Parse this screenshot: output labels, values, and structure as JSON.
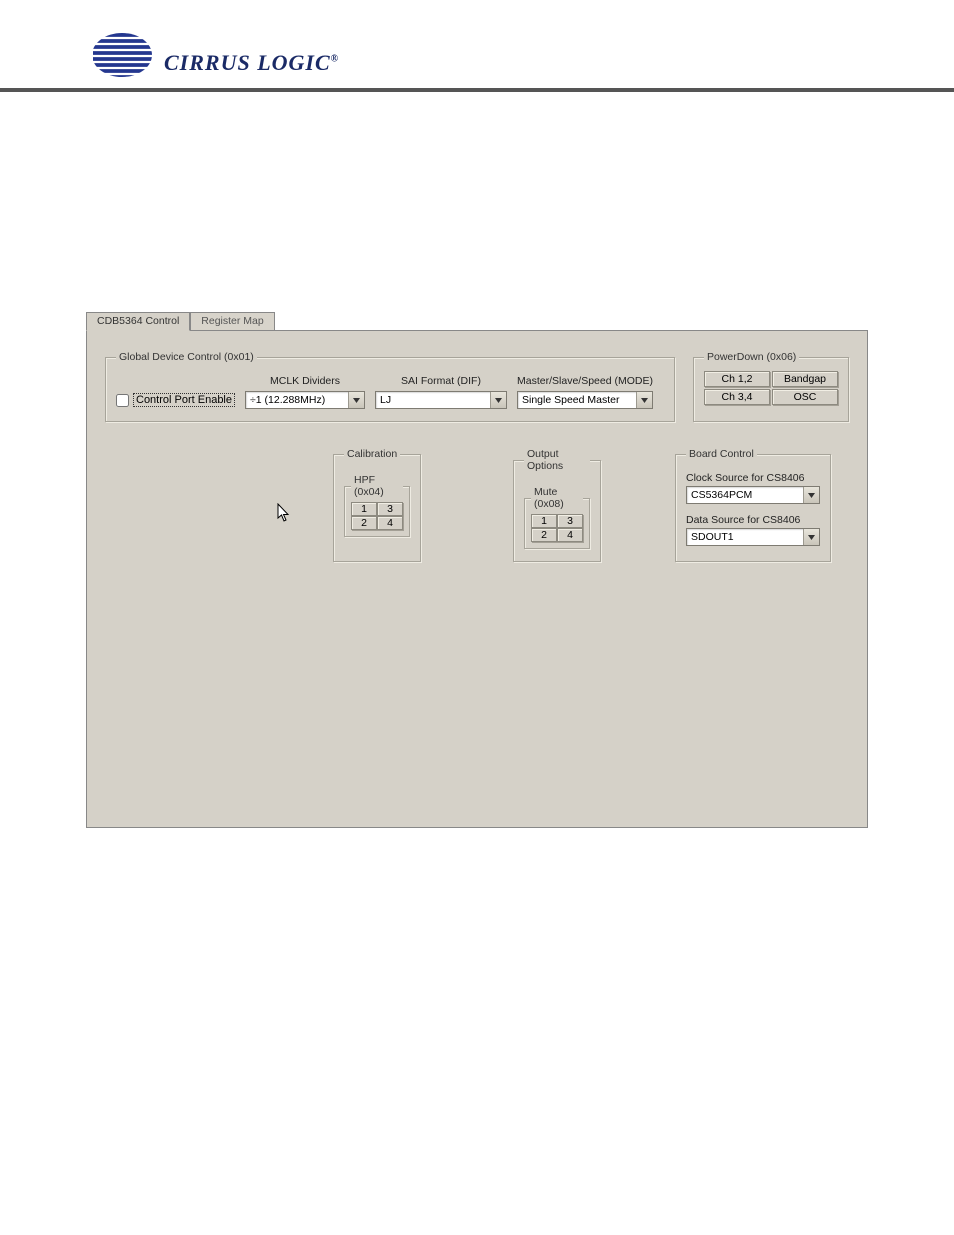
{
  "logo_text": "CIRRUS LOGIC",
  "tabs": [
    {
      "label": "CDB5364 Control",
      "active": true
    },
    {
      "label": "Register Map",
      "active": false
    }
  ],
  "gdc": {
    "legend": "Global Device Control (0x01)",
    "cport_label": "Control Port Enable",
    "mclk_label": "MCLK Dividers",
    "mclk_value": "÷1   (12.288MHz)",
    "sai_label": "SAI Format (DIF)",
    "sai_value": "LJ",
    "mode_label": "Master/Slave/Speed (MODE)",
    "mode_value": "Single Speed Master"
  },
  "powerdown": {
    "legend": "PowerDown (0x06)",
    "buttons": [
      "Ch 1,2",
      "Bandgap",
      "Ch 3,4",
      "OSC"
    ]
  },
  "calibration": {
    "legend": "Calibration",
    "hpf_legend": "HPF (0x04)",
    "cells": [
      "1",
      "3",
      "2",
      "4"
    ]
  },
  "output_options": {
    "legend": "Output Options",
    "mute_legend": "Mute (0x08)",
    "cells": [
      "1",
      "3",
      "2",
      "4"
    ]
  },
  "board_control": {
    "legend": "Board Control",
    "clock_label": "Clock Source for CS8406",
    "clock_value": "CS5364PCM",
    "data_label": "Data Source for CS8406",
    "data_value": "SDOUT1"
  }
}
